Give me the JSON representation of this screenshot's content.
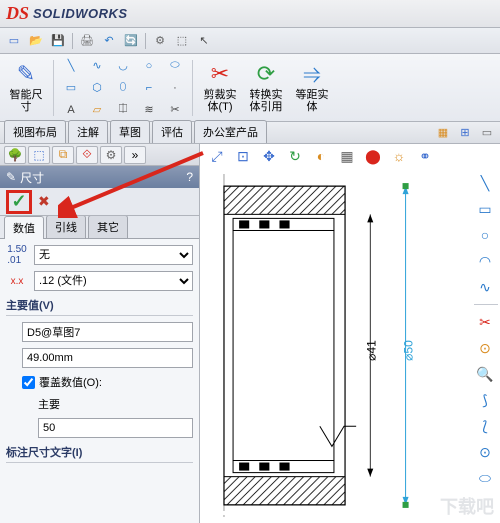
{
  "app": {
    "logo_text": "SOLIDWORKS"
  },
  "qat": [
    {
      "n": "new-icon",
      "g": "▭",
      "c": "#3a6ccf"
    },
    {
      "n": "open-icon",
      "g": "📂",
      "c": "#d9a020"
    },
    {
      "n": "save-icon",
      "g": "💾",
      "c": "#2b7acb"
    },
    {
      "n": "print-icon",
      "g": "🖨",
      "c": "#666"
    },
    {
      "n": "undo-icon",
      "g": "↶",
      "c": "#2b7acb"
    },
    {
      "n": "rebuild-icon",
      "g": "🔄",
      "c": "#2f9e44"
    },
    {
      "n": "options-icon",
      "g": "⚙",
      "c": "#666"
    },
    {
      "n": "select-icon",
      "g": "⬚",
      "c": "#444"
    },
    {
      "n": "arrow-icon",
      "g": "↖",
      "c": "#444"
    }
  ],
  "ribbon": {
    "smart_dim": {
      "label": "智能尺\n寸"
    },
    "sketch_tools": [
      {
        "n": "line-icon",
        "g": "╲",
        "c": "#2b7acb"
      },
      {
        "n": "spline-icon",
        "g": "∿",
        "c": "#2b7acb"
      },
      {
        "n": "arc-icon",
        "g": "◡",
        "c": "#2b7acb"
      },
      {
        "n": "circle-icon",
        "g": "○",
        "c": "#2b7acb"
      },
      {
        "n": "slot-icon",
        "g": "⬭",
        "c": "#2b7acb"
      },
      {
        "n": "rect-icon",
        "g": "▭",
        "c": "#2b7acb"
      },
      {
        "n": "polygon-icon",
        "g": "⬡",
        "c": "#2b7acb"
      },
      {
        "n": "ellipse-icon",
        "g": "⬯",
        "c": "#2b7acb"
      },
      {
        "n": "fillet-icon",
        "g": "⌐",
        "c": "#2b7acb"
      },
      {
        "n": "point-icon",
        "g": "·",
        "c": "#444"
      },
      {
        "n": "text-icon",
        "g": "A",
        "c": "#444"
      },
      {
        "n": "plane-icon",
        "g": "▱",
        "c": "#d98c20"
      },
      {
        "n": "mirror-icon",
        "g": "⎅",
        "c": "#444"
      },
      {
        "n": "offset-icon",
        "g": "≋",
        "c": "#444"
      },
      {
        "n": "trim-icon",
        "g": "✂",
        "c": "#444"
      }
    ],
    "trim": {
      "label": "剪裁实\n体(T)"
    },
    "convert": {
      "label": "转换实\n体引用"
    },
    "offset": {
      "label": "等距实\n体"
    }
  },
  "tabs": [
    "视图布局",
    "注解",
    "草图",
    "评估",
    "办公室产品"
  ],
  "panel": {
    "title": "尺寸",
    "help": "?",
    "subtabs": [
      "数值",
      "引线",
      "其它"
    ],
    "style_none": "无",
    "precision": ".12 (文件)",
    "primary_label": "主要值(V)",
    "primary_name": "D5@草图7",
    "primary_value": "49.00mm",
    "override_label": "覆盖数值(O):",
    "override_sub": "主要",
    "override_value": "50",
    "dimtext_label": "标注尺寸文字(I)"
  },
  "canvas_tools": [
    {
      "n": "zoom-fit-icon",
      "g": "⤢",
      "c": "#3a6ccf"
    },
    {
      "n": "zoom-area-icon",
      "g": "⊡",
      "c": "#3a6ccf"
    },
    {
      "n": "pan-icon",
      "g": "✥",
      "c": "#3a6ccf"
    },
    {
      "n": "rotate-icon",
      "g": "↻",
      "c": "#2f9e44"
    },
    {
      "n": "section-icon",
      "g": "◐",
      "c": "#d98c20"
    },
    {
      "n": "display-icon",
      "g": "▦",
      "c": "#666"
    },
    {
      "n": "appearance-icon",
      "g": "⬤",
      "c": "#d9261c"
    },
    {
      "n": "scene-icon",
      "g": "☼",
      "c": "#d98c20"
    },
    {
      "n": "link-icon",
      "g": "⚭",
      "c": "#3a6ccf"
    }
  ],
  "right_tools": [
    {
      "n": "line-tool-icon",
      "g": "╲",
      "c": "#2b7acb"
    },
    {
      "n": "rect-tool-icon",
      "g": "▭",
      "c": "#2b7acb"
    },
    {
      "n": "circle-tool-icon",
      "g": "○",
      "c": "#2b7acb"
    },
    {
      "n": "arc-tool-icon",
      "g": "◠",
      "c": "#2b7acb"
    },
    {
      "n": "spline-tool-icon",
      "g": "∿",
      "c": "#2b7acb"
    },
    {
      "n": "sep",
      "g": "",
      "c": ""
    },
    {
      "n": "cut-tool-icon",
      "g": "✂",
      "c": "#d9261c"
    },
    {
      "n": "revolve-tool-icon",
      "g": "⊙",
      "c": "#d98c20"
    },
    {
      "n": "inspect-tool-icon",
      "g": "🔍",
      "c": "#d98c20"
    },
    {
      "n": "arc2-tool-icon",
      "g": "⟆",
      "c": "#2b7acb"
    },
    {
      "n": "arc3-tool-icon",
      "g": "⟅",
      "c": "#2b7acb"
    },
    {
      "n": "point-tool-icon",
      "g": "⊙",
      "c": "#2b7acb"
    },
    {
      "n": "slot2-tool-icon",
      "g": "⬭",
      "c": "#2b7acb"
    }
  ],
  "dim": {
    "d41": "⌀41",
    "d50": "⌀50"
  },
  "watermark": "下载吧"
}
